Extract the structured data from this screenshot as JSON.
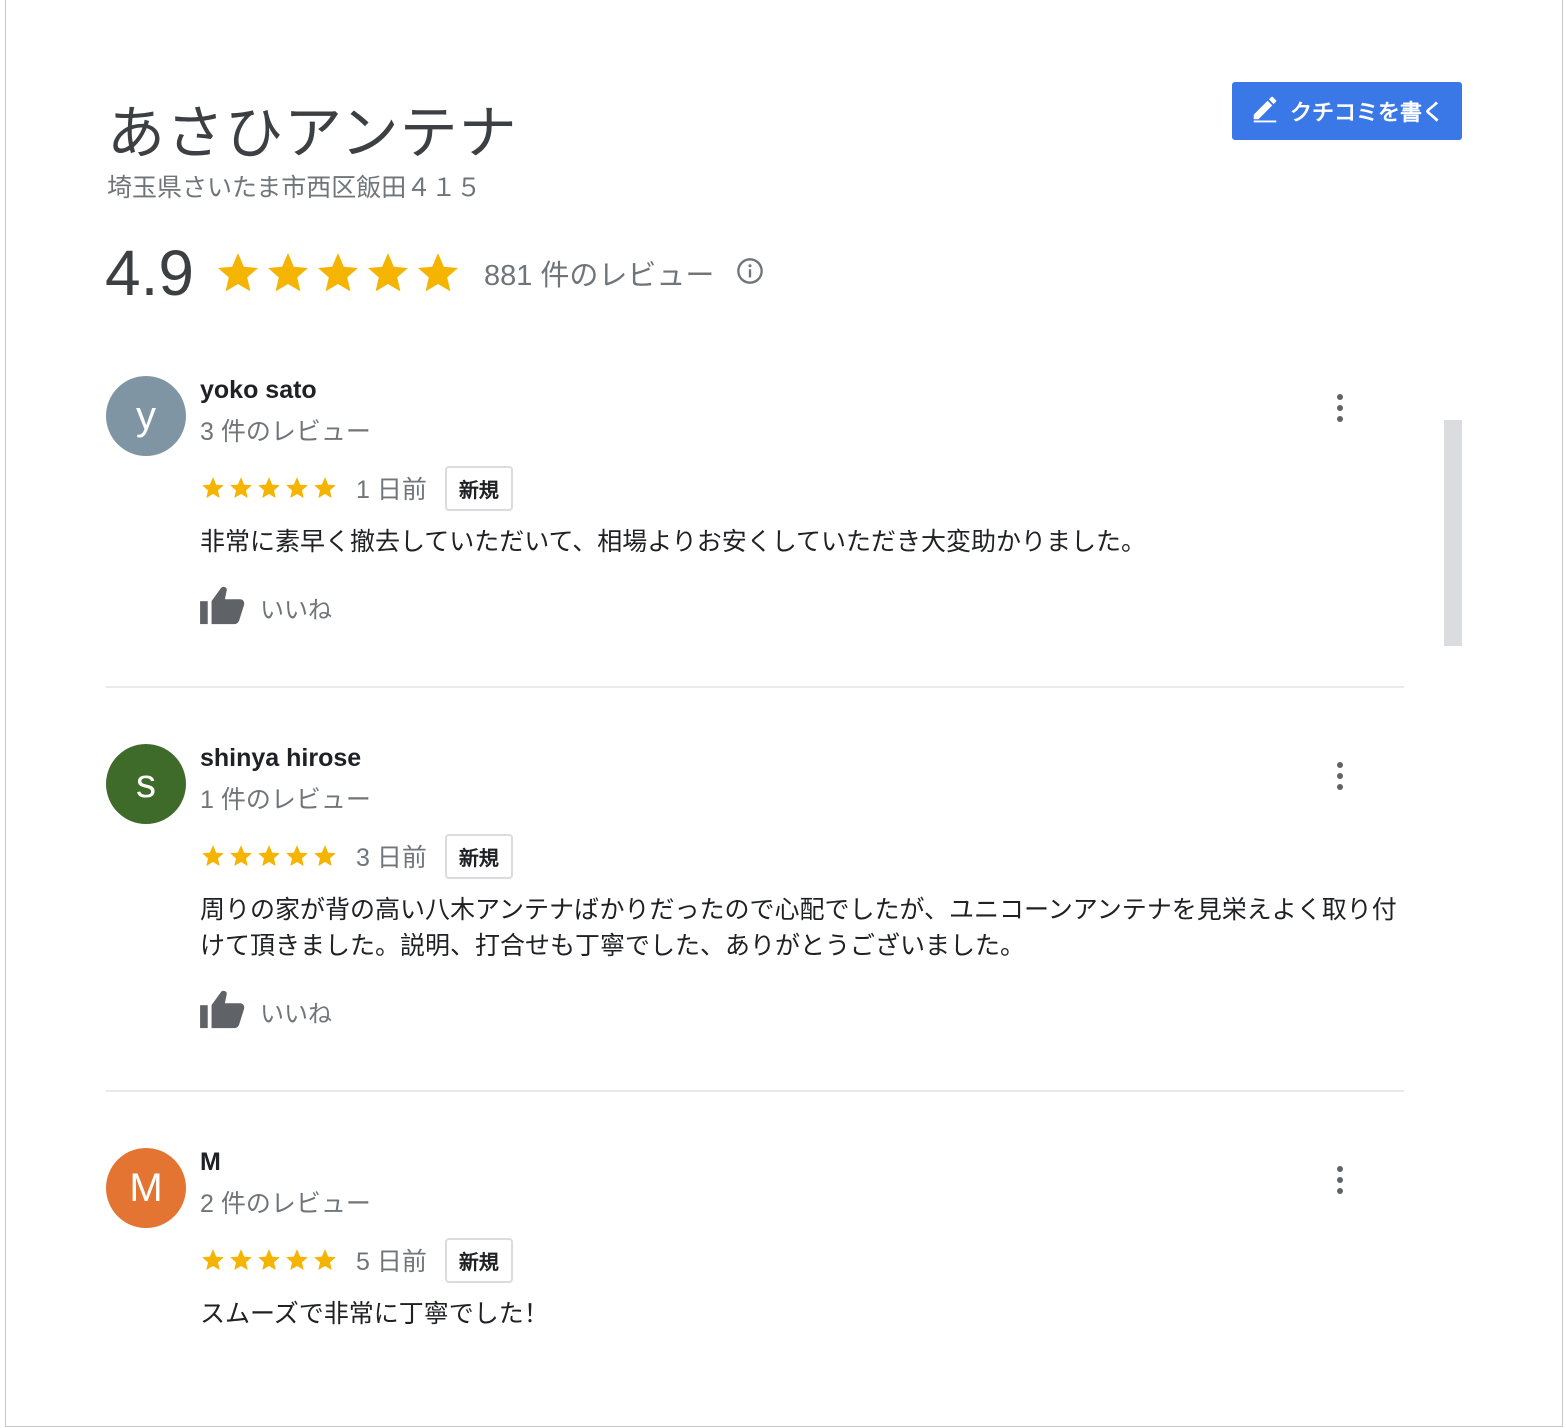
{
  "place": {
    "name": "あさひアンテナ",
    "address": "埼玉県さいたま市西区飯田４１５",
    "rating": "4.9",
    "stars": 5,
    "review_count": "881 件のレビュー"
  },
  "write_button": {
    "label": "クチコミを書く"
  },
  "colors": {
    "accent": "#3b78e7",
    "star": "#f4b400",
    "text_primary": "#202124",
    "text_secondary": "#70757a"
  },
  "reviews": [
    {
      "avatar_letter": "y",
      "avatar_color": "#7f95a3",
      "name": "yoko sato",
      "count": "3 件のレビュー",
      "stars": 5,
      "date": "1 日前",
      "badge": "新規",
      "text": "非常に素早く撤去していただいて、相場よりお安くしていただき大変助かりました。",
      "like_label": "いいね"
    },
    {
      "avatar_letter": "s",
      "avatar_color": "#3f6b2a",
      "name": "shinya hirose",
      "count": "1 件のレビュー",
      "stars": 5,
      "date": "3 日前",
      "badge": "新規",
      "text": "周りの家が背の高い八木アンテナばかりだったので心配でしたが、ユニコーンアンテナを見栄えよく取り付けて頂きました。説明、打合せも丁寧でした、ありがとうございました。",
      "like_label": "いいね"
    },
    {
      "avatar_letter": "M",
      "avatar_color": "#e37432",
      "name": "M",
      "count": "2 件のレビュー",
      "stars": 5,
      "date": "5 日前",
      "badge": "新規",
      "text": "スムーズで非常に丁寧でした！",
      "like_label": "いいね"
    }
  ]
}
